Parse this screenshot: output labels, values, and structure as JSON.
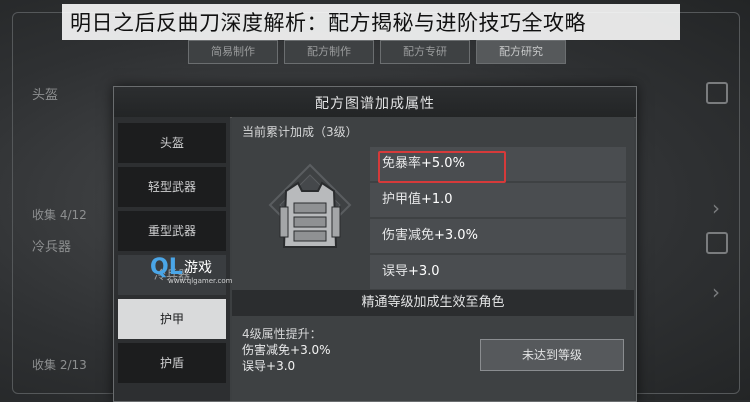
{
  "banner": {
    "title": "明日之后反曲刀深度解析：配方揭秘与进阶技巧全攻略"
  },
  "background": {
    "tabs": [
      "简易制作",
      "配方制作",
      "配方专研",
      "配方研究"
    ],
    "left_title": "头盔",
    "left_items": [
      "收集 4/12",
      "冷兵器",
      "收集 2/13"
    ]
  },
  "dialog": {
    "title": "配方图谱加成属性",
    "sidebar": [
      {
        "label": "头盔"
      },
      {
        "label": "轻型武器"
      },
      {
        "label": "重型武器"
      },
      {
        "label": "冷兵器"
      },
      {
        "label": "护甲",
        "active": true
      },
      {
        "label": "护盾"
      }
    ],
    "accumulated_label": "当前累计加成（3级）",
    "stats": [
      {
        "name": "免暴率",
        "value": "+5.0%",
        "highlighted": true
      },
      {
        "name": "护甲值",
        "value": "+1.0"
      },
      {
        "name": "伤害减免",
        "value": "+3.0%"
      },
      {
        "name": "误导",
        "value": "+3.0"
      }
    ],
    "mastery_bar": "精通等级加成生效至角色",
    "level_up": {
      "label": "4级属性提升：",
      "stats": [
        {
          "name": "伤害减免",
          "value": "+3.0%"
        },
        {
          "name": "误导",
          "value": "+3.0"
        }
      ],
      "button": "未达到等级"
    }
  },
  "watermark": {
    "logo": "QL",
    "text": "游戏",
    "url": "www.qlgamer.com"
  },
  "colors": {
    "highlight_border": "#d63a3a",
    "active_tab_bg": "#d9dadb",
    "watermark_blue": "#4aa6e8"
  }
}
